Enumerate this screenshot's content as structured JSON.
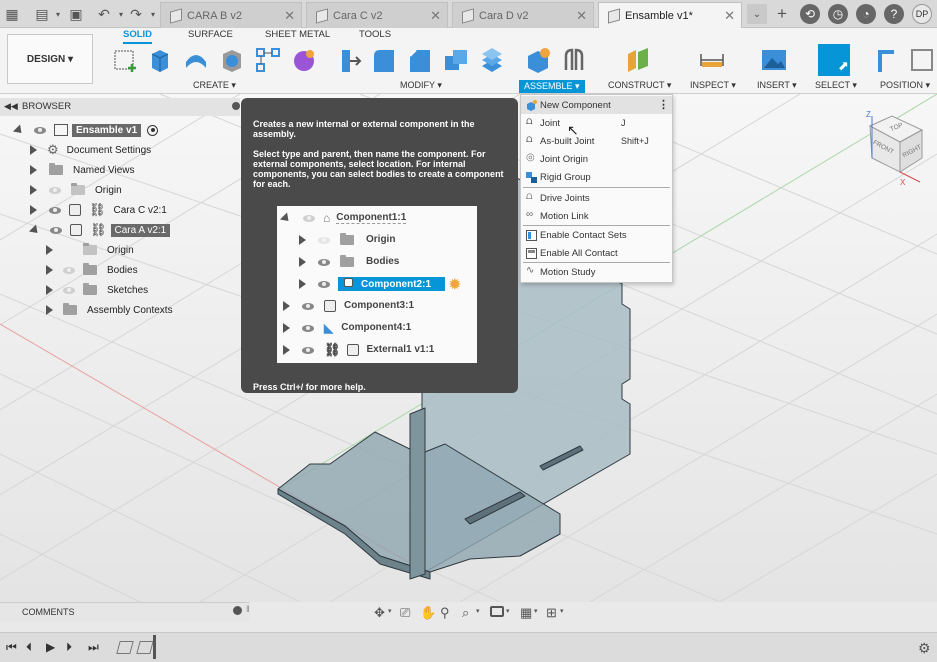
{
  "tabs": {
    "documents": [
      {
        "label": "CARA B v2"
      },
      {
        "label": "Cara C v2"
      },
      {
        "label": "Cara D v2"
      },
      {
        "label": "Ensamble v1*"
      }
    ],
    "avatar": "DP"
  },
  "toolbar": {
    "workspace": "DESIGN",
    "tabs": [
      "SOLID",
      "SURFACE",
      "SHEET METAL",
      "TOOLS"
    ],
    "groups": [
      "CREATE ▾",
      "MODIFY ▾",
      "ASSEMBLE ▾",
      "CONSTRUCT ▾",
      "INSPECT ▾",
      "INSERT ▾",
      "SELECT ▾",
      "POSITION ▾"
    ]
  },
  "browser": {
    "title": "BROWSER",
    "items": [
      {
        "label": "Ensamble v1"
      },
      {
        "label": "Document Settings"
      },
      {
        "label": "Named Views"
      },
      {
        "label": "Origin"
      },
      {
        "label": "Cara C v2:1"
      },
      {
        "label": "Cara A v2:1"
      },
      {
        "label": "Origin"
      },
      {
        "label": "Bodies"
      },
      {
        "label": "Sketches"
      },
      {
        "label": "Assembly Contexts"
      }
    ]
  },
  "tooltip": {
    "line1": "Creates a new internal or external component in the assembly.",
    "line2": "Select type and parent, then name the component. For external components, select location. For internal components, you can select bodies to create a component for each.",
    "footer": "Press Ctrl+/ for more help.",
    "preview": [
      {
        "label": "Component1:1"
      },
      {
        "label": "Origin"
      },
      {
        "label": "Bodies"
      },
      {
        "label": "Component2:1"
      },
      {
        "label": "Component3:1"
      },
      {
        "label": "Component4:1"
      },
      {
        "label": "External1 v1:1"
      }
    ]
  },
  "assemble_menu": {
    "items": [
      {
        "label": "New Component",
        "shortcut": ""
      },
      {
        "label": "Joint",
        "shortcut": "J"
      },
      {
        "label": "As-built Joint",
        "shortcut": "Shift+J"
      },
      {
        "label": "Joint Origin",
        "shortcut": ""
      },
      {
        "label": "Rigid Group",
        "shortcut": ""
      },
      {
        "label": "Drive Joints",
        "shortcut": ""
      },
      {
        "label": "Motion Link",
        "shortcut": ""
      },
      {
        "label": "Enable Contact Sets",
        "shortcut": ""
      },
      {
        "label": "Enable All Contact",
        "shortcut": ""
      },
      {
        "label": "Motion Study",
        "shortcut": ""
      }
    ]
  },
  "viewcube": {
    "top": "TOP",
    "front": "FRONT",
    "right": "RIGHT",
    "z": "Z",
    "x": "X"
  },
  "comments": {
    "label": "COMMENTS"
  },
  "colors": {
    "accent": "#0696d7",
    "tooltip_bg": "#4a4a4a",
    "part": "#9eb3bc"
  }
}
